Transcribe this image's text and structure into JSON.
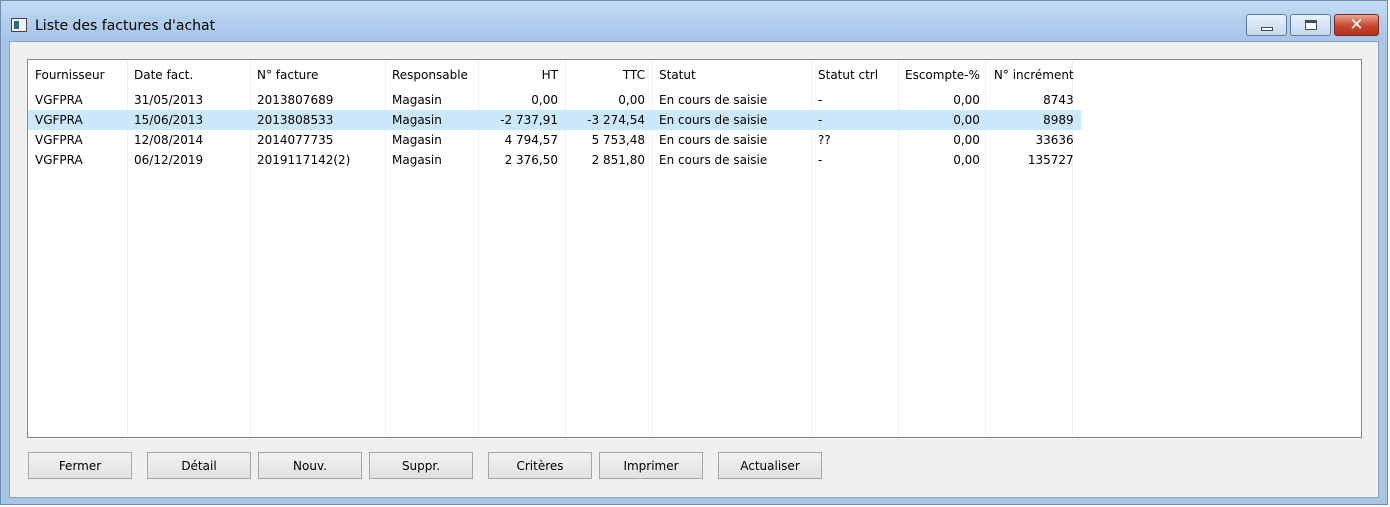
{
  "window": {
    "title": "Liste des factures d'achat",
    "close_glyph": "✕"
  },
  "table": {
    "columns": [
      "Fournisseur",
      "Date fact.",
      "N° facture",
      "Responsable",
      "HT",
      "TTC",
      "Statut",
      "Statut ctrl",
      "Escompte-%",
      "N° incrément"
    ],
    "rows": [
      [
        "VGFPRA",
        "31/05/2013",
        "2013807689",
        "Magasin",
        "0,00",
        "0,00",
        "En cours de saisie",
        "-",
        "0,00",
        "8743"
      ],
      [
        "VGFPRA",
        "15/06/2013",
        "2013808533",
        "Magasin",
        "-2 737,91",
        "-3 274,54",
        "En cours de saisie",
        "-",
        "0,00",
        "8989"
      ],
      [
        "VGFPRA",
        "12/08/2014",
        "2014077735",
        "Magasin",
        "4 794,57",
        "5 753,48",
        "En cours de saisie",
        "??",
        "0,00",
        "33636"
      ],
      [
        "VGFPRA",
        "06/12/2019",
        "2019117142(2)",
        "Magasin",
        "2 376,50",
        "2 851,80",
        "En cours de saisie",
        "-",
        "0,00",
        "135727"
      ]
    ],
    "selected_row": 1
  },
  "buttons": {
    "fermer": "Fermer",
    "detail": "Détail",
    "nouv": "Nouv.",
    "suppr": "Suppr.",
    "criteres": "Critères",
    "imprimer": "Imprimer",
    "actualiser": "Actualiser"
  }
}
